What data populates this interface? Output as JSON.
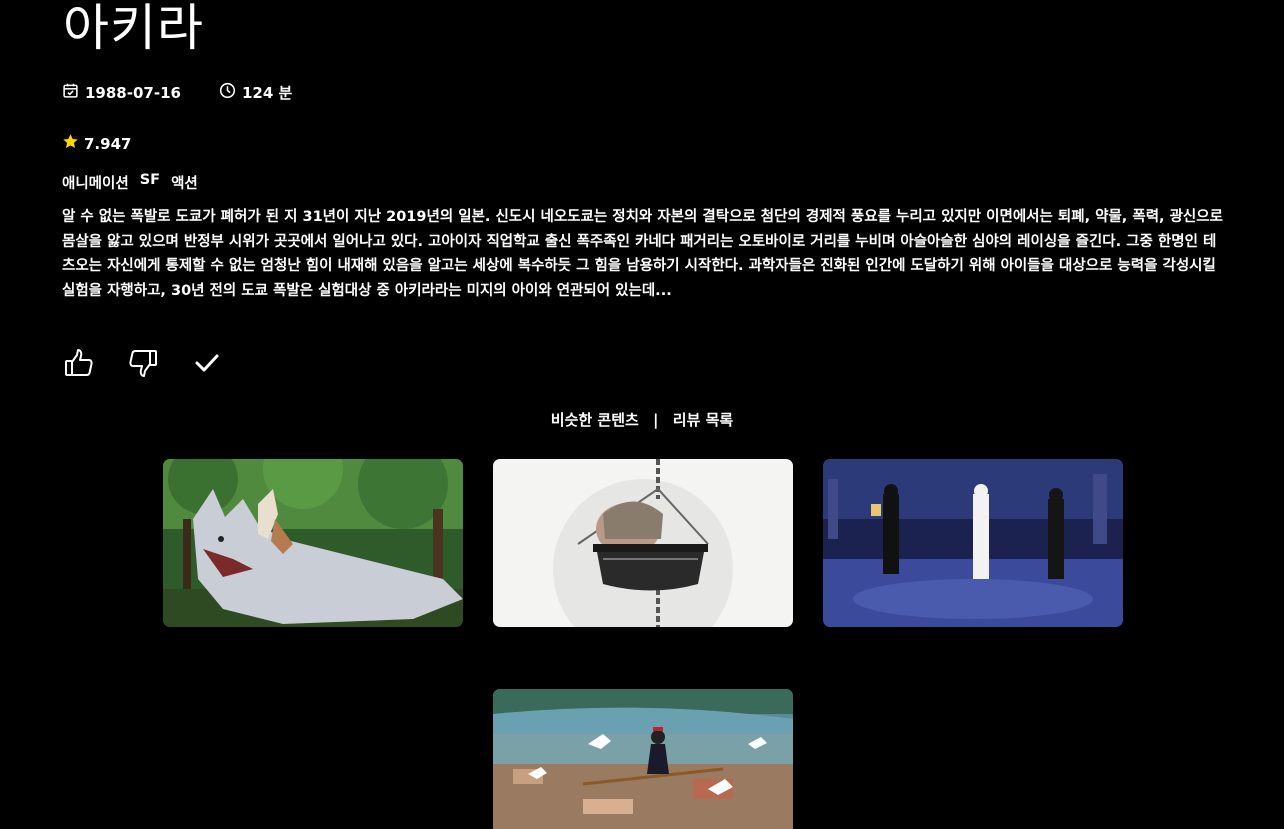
{
  "movie": {
    "title": "아키라",
    "release_date": "1988-07-16",
    "runtime": "124 분",
    "rating": "7.947",
    "genres": [
      "애니메이션",
      "SF",
      "액션"
    ],
    "overview": "알 수 없는 폭발로 도쿄가 폐허가 된 지 31년이 지난 2019년의 일본. 신도시 네오도쿄는 정치와 자본의 결탁으로 첨단의 경제적 풍요를 누리고 있지만 이면에서는 퇴폐, 약물, 폭력, 광신으로 몸살을 앓고 있으며 반정부 시위가 곳곳에서 일어나고 있다. 고아이자 직업학교 출신 폭주족인 카네다 패거리는 오토바이로 거리를 누비며 아슬아슬한 심야의 레이싱을 즐긴다. 그중 한명인 테츠오는 자신에게 통제할 수 없는 엄청난 힘이 내재해 있음을 알고는 세상에 복수하듯 그 힘을 남용하기 시작한다. 과학자들은 진화된 인간에 도달하기 위해 아이들을 대상으로 능력을 각성시킬 실험을 자행하고, 30년 전의 도쿄 폭발은 실험대상 중 아키라라는 미지의 아이와 연관되어 있는데..."
  },
  "icons": {
    "release": "calendar-check-icon",
    "runtime": "clock-icon",
    "rating": "star-icon",
    "like": "thumbs-up-icon",
    "dislike": "thumbs-down-icon",
    "watched": "check-icon"
  },
  "colors": {
    "background": "#000000",
    "text": "#ffffff",
    "star": "#ffd700"
  },
  "tabs": {
    "similar": "비슷한 콘텐츠",
    "separator": "|",
    "reviews": "리뷰 목록"
  },
  "similar_contents": [
    {
      "scene": "white-wolf-and-girl-forest-poster"
    },
    {
      "scene": "head-in-hanging-pot-poster"
    },
    {
      "scene": "dancers-in-club-poster"
    },
    {
      "scene": "witch-on-broom-over-city-poster"
    }
  ]
}
